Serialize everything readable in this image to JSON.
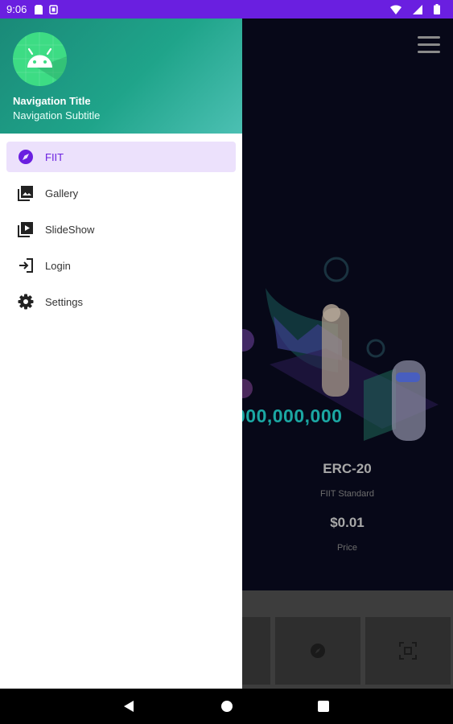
{
  "status_bar": {
    "time": "9:06",
    "color": "#6a1fe0"
  },
  "drawer": {
    "header": {
      "title": "Navigation Title",
      "subtitle": "Navigation Subtitle",
      "avatar_icon": "android-icon"
    },
    "items": [
      {
        "label": "FIIT",
        "icon": "compass-icon",
        "active": true
      },
      {
        "label": "Gallery",
        "icon": "image-icon",
        "active": false
      },
      {
        "label": "SlideShow",
        "icon": "slideshow-icon",
        "active": false
      },
      {
        "label": "Login",
        "icon": "login-icon",
        "active": false
      },
      {
        "label": "Settings",
        "icon": "gear-icon",
        "active": false
      }
    ]
  },
  "app": {
    "supply": "000,000,000",
    "token_name": "ERC-20",
    "token_standard": "FIIT Standard",
    "price": "$0.01",
    "price_label": "Price"
  },
  "colors": {
    "accent": "#6a1fe0",
    "header_gradient": "#1fa48a",
    "active_item_bg": "#ece1fc"
  }
}
